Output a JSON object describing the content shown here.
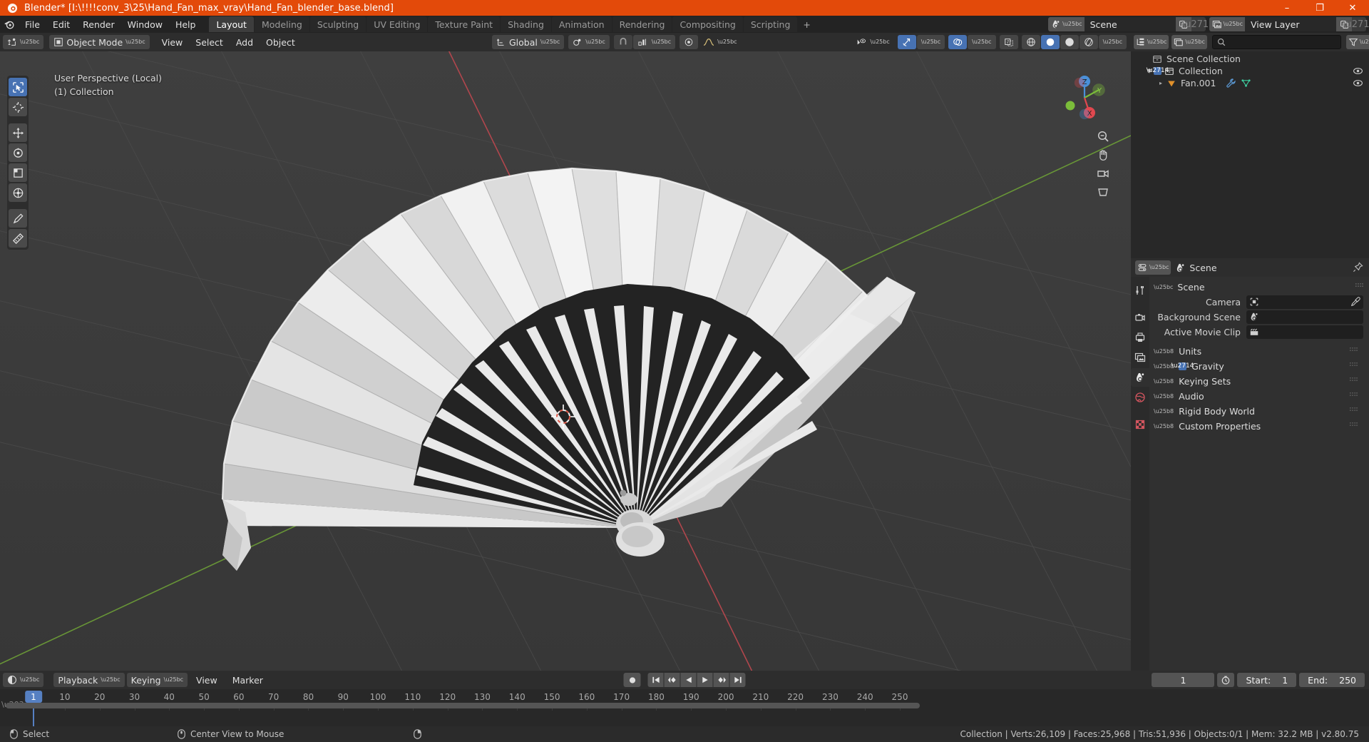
{
  "window": {
    "title": "Blender* [I:\\!!!!conv_3\\25\\Hand_Fan_max_vray\\Hand_Fan_blender_base.blend]",
    "minimize_label": "–",
    "maximize_label": "❐",
    "close_label": "✕"
  },
  "topbar": {
    "menus": [
      "File",
      "Edit",
      "Render",
      "Window",
      "Help"
    ],
    "workspaces": [
      {
        "label": "Layout",
        "active": true
      },
      {
        "label": "Modeling",
        "active": false
      },
      {
        "label": "Sculpting",
        "active": false
      },
      {
        "label": "UV Editing",
        "active": false
      },
      {
        "label": "Texture Paint",
        "active": false
      },
      {
        "label": "Shading",
        "active": false
      },
      {
        "label": "Animation",
        "active": false
      },
      {
        "label": "Rendering",
        "active": false
      },
      {
        "label": "Compositing",
        "active": false
      },
      {
        "label": "Scripting",
        "active": false
      }
    ],
    "add_workspace_label": "+",
    "scene_name": "Scene",
    "view_layer_name": "View Layer"
  },
  "viewport": {
    "mode": "Object Mode",
    "menus": [
      "View",
      "Select",
      "Add",
      "Object"
    ],
    "transform_orientation": "Global",
    "overlay_line1": "User Perspective (Local)",
    "overlay_line2": "(1) Collection",
    "gizmo_axes": {
      "x": "X",
      "y": "Y",
      "z": "Z"
    },
    "shading_active": "solid"
  },
  "outliner": {
    "search_placeholder": "",
    "search_value": "",
    "rows": [
      {
        "label": "Scene Collection",
        "indent": 0,
        "type": "scene-collection",
        "disclosure": "",
        "checkbox": false,
        "eye": false
      },
      {
        "label": "Collection",
        "indent": 1,
        "type": "collection",
        "disclosure": "▼",
        "checkbox": true,
        "eye": true
      },
      {
        "label": "Fan.001",
        "indent": 2,
        "type": "mesh-object",
        "disclosure": "▸",
        "checkbox": false,
        "eye": true
      }
    ]
  },
  "properties": {
    "breadcrumb": "Scene",
    "panel_title": "Scene",
    "rows": [
      {
        "label": "Camera",
        "value": "",
        "icon": "camera-icon",
        "eyedropper": true
      },
      {
        "label": "Background Scene",
        "value": "",
        "icon": "scene-icon",
        "eyedropper": false
      },
      {
        "label": "Active Movie Clip",
        "value": "",
        "icon": "clip-icon",
        "eyedropper": false
      }
    ],
    "sections": [
      {
        "label": "Units",
        "checkbox": null
      },
      {
        "label": "Gravity",
        "checkbox": true
      },
      {
        "label": "Keying Sets",
        "checkbox": null
      },
      {
        "label": "Audio",
        "checkbox": null
      },
      {
        "label": "Rigid Body World",
        "checkbox": null
      },
      {
        "label": "Custom Properties",
        "checkbox": null
      }
    ]
  },
  "timeline": {
    "menus": [
      "Playback",
      "Keying",
      "View",
      "Marker"
    ],
    "current_frame": "1",
    "start_label": "Start:",
    "start_value": "1",
    "end_label": "End:",
    "end_value": "250",
    "ruler_ticks": [
      "10",
      "20",
      "30",
      "40",
      "50",
      "60",
      "70",
      "80",
      "90",
      "100",
      "110",
      "120",
      "130",
      "140",
      "150",
      "160",
      "170",
      "180",
      "190",
      "200",
      "210",
      "220",
      "230",
      "240",
      "250"
    ],
    "playhead_frame": "1"
  },
  "statusbar": {
    "mouse_left_action": "Select",
    "mouse_middle_action": "Center View to Mouse",
    "stats": "Collection | Verts:26,109 | Faces:25,968 | Tris:51,936 | Objects:0/1 | Mem: 32.2 MB | v2.80.75"
  },
  "colors": {
    "title_bar": "#e34a0a",
    "accent_blue": "#4772b3",
    "playhead": "#5680c2",
    "axis_x": "#e0484f",
    "axis_y": "#7bbd3a",
    "outliner_object": "#e1912b"
  }
}
